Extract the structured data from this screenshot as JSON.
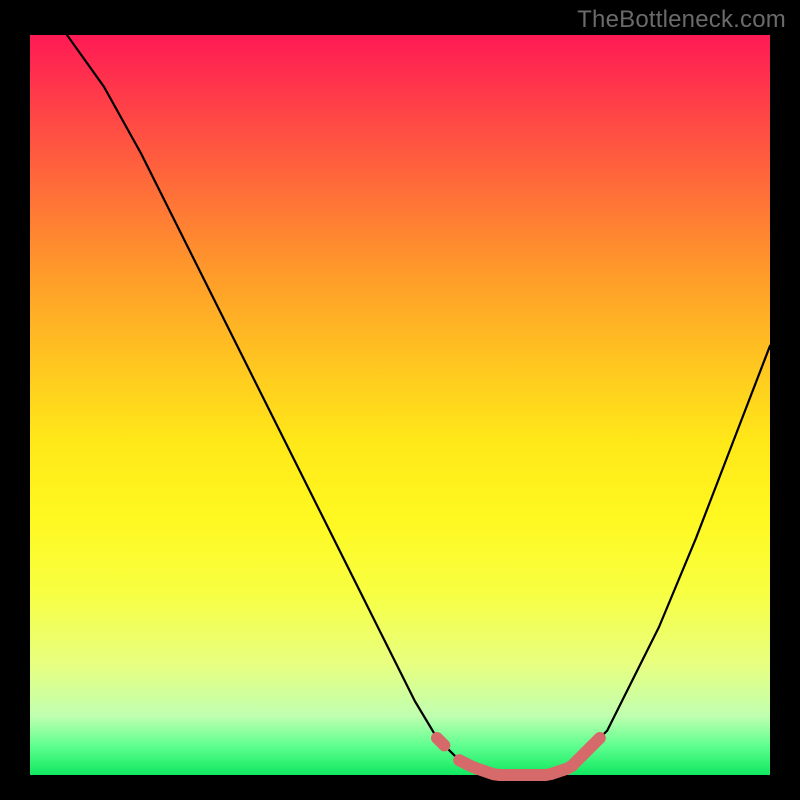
{
  "watermark": "TheBottleneck.com",
  "colors": {
    "background": "#000000",
    "curve": "#000000",
    "highlight": "#d66a6a",
    "gradient_top": "#ff1a54",
    "gradient_bottom": "#10e860"
  },
  "chart_data": {
    "type": "line",
    "title": "",
    "xlabel": "",
    "ylabel": "",
    "xlim": [
      0,
      100
    ],
    "ylim": [
      0,
      100
    ],
    "series": [
      {
        "name": "bottleneck-curve",
        "x": [
          5,
          10,
          15,
          20,
          25,
          30,
          35,
          40,
          45,
          50,
          52,
          55,
          58,
          60,
          63,
          65,
          68,
          70,
          73,
          75,
          78,
          80,
          85,
          90,
          95,
          100
        ],
        "y": [
          100,
          93,
          84,
          74,
          64,
          54,
          44,
          34,
          24,
          14,
          10,
          5,
          2,
          1,
          0,
          0,
          0,
          0,
          1,
          3,
          6,
          10,
          20,
          32,
          45,
          58
        ]
      }
    ],
    "highlight_ranges": [
      {
        "name": "left-dot",
        "x_start": 55,
        "x_end": 56
      },
      {
        "name": "valley",
        "x_start": 58,
        "x_end": 72
      },
      {
        "name": "right-rise",
        "x_start": 72,
        "x_end": 77
      }
    ],
    "legend": false,
    "grid": false
  }
}
